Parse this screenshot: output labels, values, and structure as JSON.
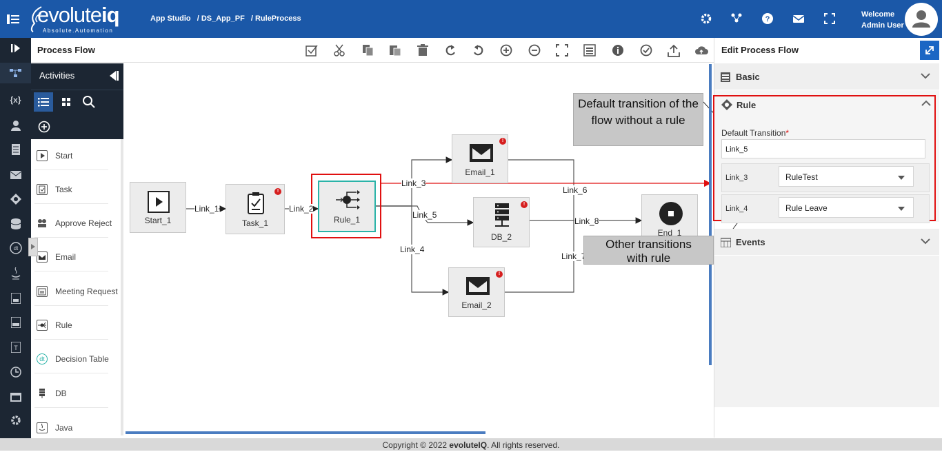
{
  "header": {
    "brand": "evoluteiq",
    "brand_first": "evolute",
    "brand_second": "iq",
    "tagline": "Absolute.Automation",
    "breadcrumb": [
      "App Studio",
      "/ DS_App_PF",
      "/ RuleProcess"
    ],
    "welcome_line1": "Welcome",
    "welcome_line2": "Admin User",
    "icons": [
      "gear-icon",
      "network-icon",
      "help-icon",
      "mail-icon",
      "fullscreen-icon"
    ]
  },
  "leftrail": {
    "icons": [
      "expand-rail-icon",
      "process-flow-icon",
      "variables-icon",
      "user-icon",
      "document-icon",
      "mail-icon",
      "rule-icon",
      "database-icon",
      "decision-table-icon",
      "java-icon",
      "report-icon",
      "css-icon",
      "text-icon",
      "clock-icon",
      "calendar-icon",
      "settings-cog-icon"
    ],
    "variables_label": "{x}"
  },
  "process_flow": {
    "title": "Process Flow",
    "toolbar": [
      "select-icon",
      "cut-icon",
      "copy-icon",
      "paste-icon",
      "delete-icon",
      "undo-icon",
      "redo-icon",
      "zoom-in-icon",
      "zoom-out-icon",
      "fit-icon",
      "grid-icon",
      "info-icon",
      "validate-icon",
      "export-icon",
      "deploy-icon"
    ]
  },
  "activities": {
    "title": "Activities",
    "items": [
      {
        "label": "Start",
        "icon": "start-icon"
      },
      {
        "label": "Task",
        "icon": "task-icon"
      },
      {
        "label": "Approve Reject",
        "icon": "approve-icon"
      },
      {
        "label": "Email",
        "icon": "email-icon"
      },
      {
        "label": "Meeting Request",
        "icon": "meeting-icon"
      },
      {
        "label": "Rule",
        "icon": "rule-icon"
      },
      {
        "label": "Decision Table",
        "icon": "decision-table-icon"
      },
      {
        "label": "DB",
        "icon": "db-icon"
      },
      {
        "label": "Java",
        "icon": "java-icon"
      }
    ]
  },
  "diagram": {
    "nodes": {
      "start": "Start_1",
      "task": "Task_1",
      "rule": "Rule_1",
      "email1": "Email_1",
      "db": "DB_2",
      "email2": "Email_2",
      "end": "End_1"
    },
    "links": {
      "l1": "Link_1",
      "l2": "Link_2",
      "l3": "Link_3",
      "l4": "Link_4",
      "l5": "Link_5",
      "l6": "Link_6",
      "l7": "Link_7",
      "l8": "Link_8"
    },
    "error_mark": "!"
  },
  "callouts": {
    "default": "Default transition of the flow without a rule",
    "others": "Other transitions with rule"
  },
  "edit_panel": {
    "title": "Edit Process Flow",
    "basic": "Basic",
    "rule": "Rule",
    "events": "Events",
    "default_transition_label": "Default Transition",
    "required_mark": "*",
    "default_transition_value": "Link_5",
    "rows": [
      {
        "link": "Link_3",
        "rule": "RuleTest"
      },
      {
        "link": "Link_4",
        "rule": "Rule Leave"
      }
    ]
  },
  "footer": {
    "text_before": "Copyright © 2022 ",
    "brand": "evoluteIQ",
    "text_after": ". All rights reserved."
  },
  "colors": {
    "header": "#1b58a8",
    "rail": "#1c2633",
    "highlight": "#e01010",
    "rule_selected": "#2ab3a8"
  }
}
